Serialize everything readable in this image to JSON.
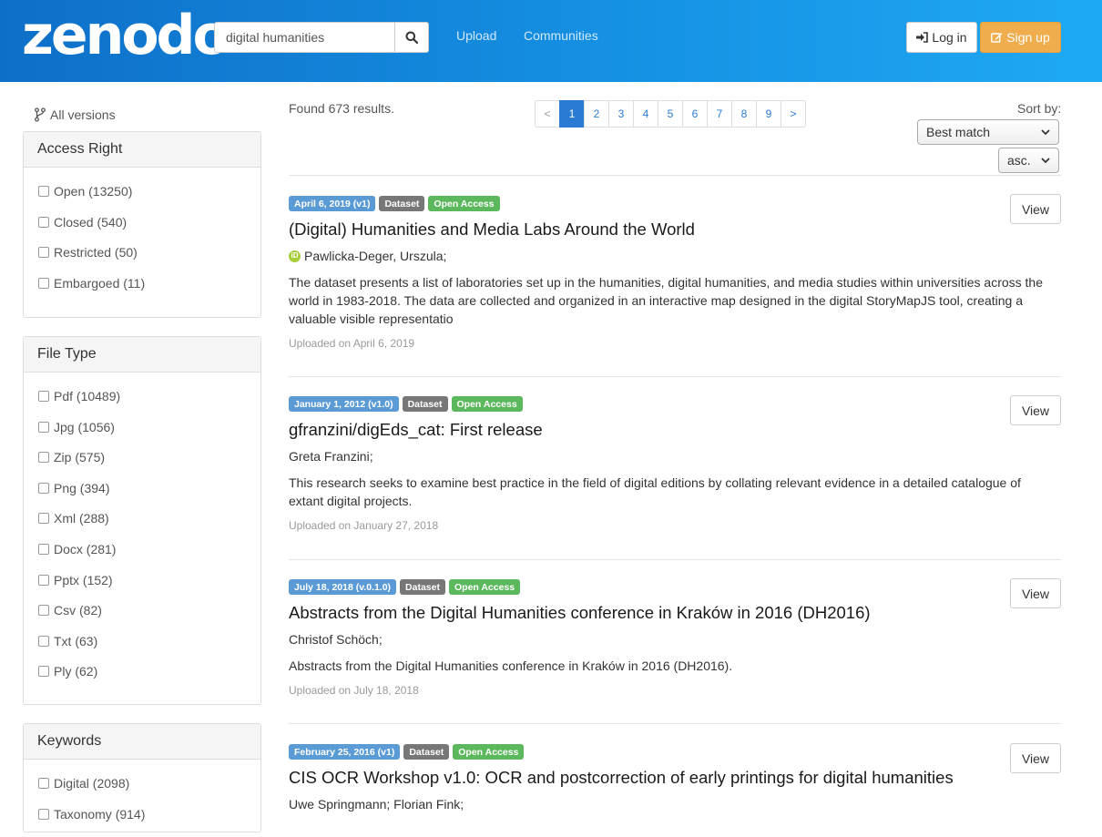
{
  "header": {
    "logo": "zenodo",
    "search_value": "digital humanities",
    "nav": [
      "Upload",
      "Communities"
    ],
    "login": "Log in",
    "signup": "Sign up"
  },
  "sidebar": {
    "all_versions": "All versions",
    "access_right": {
      "title": "Access Right",
      "items": [
        "Open (13250)",
        "Closed (540)",
        "Restricted (50)",
        "Embargoed (11)"
      ]
    },
    "file_type": {
      "title": "File Type",
      "items": [
        "Pdf (10489)",
        "Jpg (1056)",
        "Zip (575)",
        "Png (394)",
        "Xml (288)",
        "Docx (281)",
        "Pptx (152)",
        "Csv (82)",
        "Txt (63)",
        "Ply (62)"
      ]
    },
    "keywords": {
      "title": "Keywords",
      "items": [
        "Digital (2098)",
        "Taxonomy (914)"
      ]
    }
  },
  "results": {
    "found": "Found 673 results.",
    "pagination": [
      "<",
      "1",
      "2",
      "3",
      "4",
      "5",
      "6",
      "7",
      "8",
      "9",
      ">"
    ],
    "current_page": "1",
    "sort_label": "Sort by:",
    "sort_value": "Best match",
    "order_value": "asc.",
    "view_label": "View",
    "records": [
      {
        "date_label": "April 6, 2019 (v1)",
        "type_label": "Dataset",
        "access_label": "Open Access",
        "title": "(Digital) Humanities and Media Labs Around the World",
        "authors": "Pawlicka-Deger, Urszula;",
        "orcid": "iD",
        "description": "The dataset presents a list of laboratories set up in the humanities, digital humanities, and media studies within universities across the world in 1983-2018. The data are collected and organized in an interactive map designed in the digital StoryMapJS tool, creating a valuable visible representatio",
        "uploaded": "Uploaded on April 6, 2019"
      },
      {
        "date_label": "January 1, 2012 (v1.0)",
        "type_label": "Dataset",
        "access_label": "Open Access",
        "title": "gfranzini/digEds_cat: First release",
        "authors": "Greta Franzini;",
        "description": "This research seeks to examine best practice in the field of digital editions by collating relevant evidence in a detailed catalogue of extant digital projects.",
        "uploaded": "Uploaded on January 27, 2018"
      },
      {
        "date_label": "July 18, 2018 (v.0.1.0)",
        "type_label": "Dataset",
        "access_label": "Open Access",
        "title": "Abstracts from the Digital Humanities conference in Kraków in 2016 (DH2016)",
        "authors": "Christof Schöch;",
        "description": "Abstracts from the Digital Humanities conference in Kraków in 2016 (DH2016).",
        "uploaded": "Uploaded on July 18, 2018"
      },
      {
        "date_label": "February 25, 2016 (v1)",
        "type_label": "Dataset",
        "access_label": "Open Access",
        "title": "CIS OCR Workshop v1.0: OCR and postcorrection of early printings for digital humanities",
        "authors": "Uwe Springmann; Florian Fink;"
      }
    ]
  }
}
